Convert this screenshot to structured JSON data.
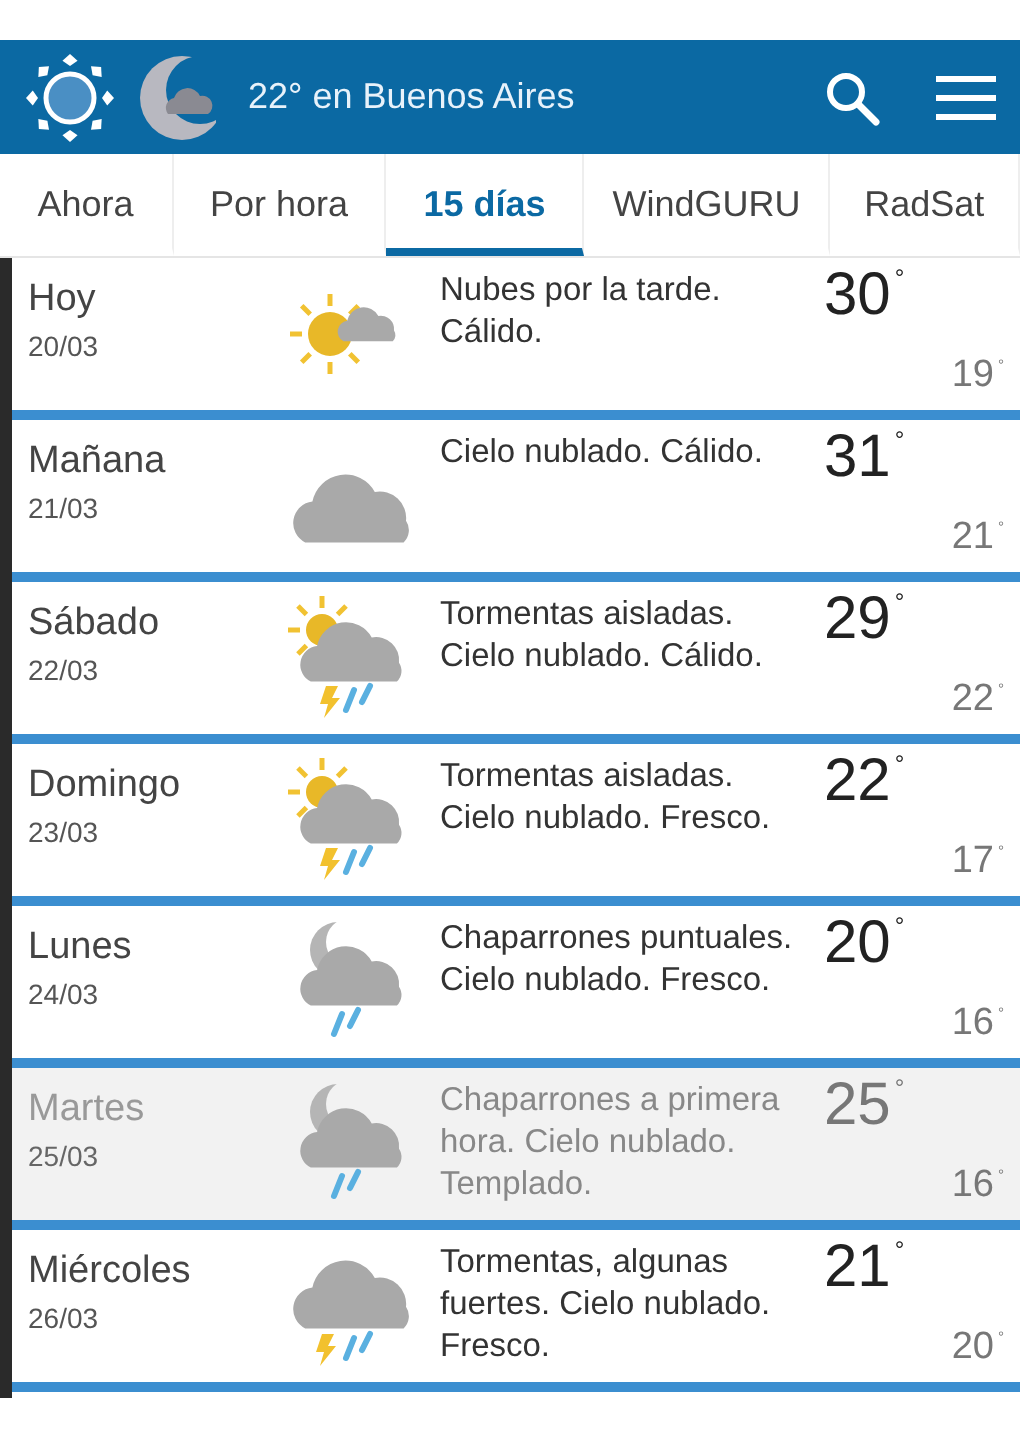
{
  "header": {
    "title": "22° en Buenos Aires"
  },
  "tabs": [
    {
      "label": "Ahora",
      "selected": false
    },
    {
      "label": "Por hora",
      "selected": false
    },
    {
      "label": "15 días",
      "selected": true
    },
    {
      "label": "WindGURU",
      "selected": false
    },
    {
      "label": "RadSat",
      "selected": false
    }
  ],
  "days": [
    {
      "day": "Hoy",
      "date": "20/03",
      "kind": "sun-cloud",
      "summary": "Nubes por la tarde. Cálido.",
      "high": "30$^{°}$",
      "low": "19$^{°}$",
      "dimmed": false
    },
    {
      "day": "Mañana",
      "date": "21/03",
      "kind": "cloud",
      "summary": "Cielo nublado. Cálido.",
      "high": "31$^{°}$",
      "low": "21$^{°}$",
      "dimmed": false
    },
    {
      "day": "Sábado",
      "date": "22/03",
      "kind": "sun-storm",
      "summary": "Tormentas aisladas. Cielo nublado. Cálido.",
      "high": "29$^{°}$",
      "low": "22$^{°}$",
      "dimmed": false
    },
    {
      "day": "Domingo",
      "date": "23/03",
      "kind": "sun-storm",
      "summary": "Tormentas aisladas. Cielo nublado. Fresco.",
      "high": "22$^{°}$",
      "low": "17$^{°}$",
      "dimmed": false
    },
    {
      "day": "Lunes",
      "date": "24/03",
      "kind": "moon-rain",
      "summary": "Chaparrones puntuales. Cielo nublado. Fresco.",
      "high": "20$^{°}$",
      "low": "16$^{°}$",
      "dimmed": false
    },
    {
      "day": "Martes",
      "date": "25/03",
      "kind": "moon-rain",
      "summary": "Chaparrones a primera hora. Cielo nublado. Templado.",
      "high": "25$^{°}$",
      "low": "16$^{°}$",
      "dimmed": true
    },
    {
      "day": "Miércoles",
      "date": "26/03",
      "kind": "storm",
      "summary": "Tormentas, algunas fuertes. Cielo nublado. Fresco.",
      "high": "21$^{°}$",
      "low": "20$^{°}$",
      "dimmed": false
    }
  ]
}
